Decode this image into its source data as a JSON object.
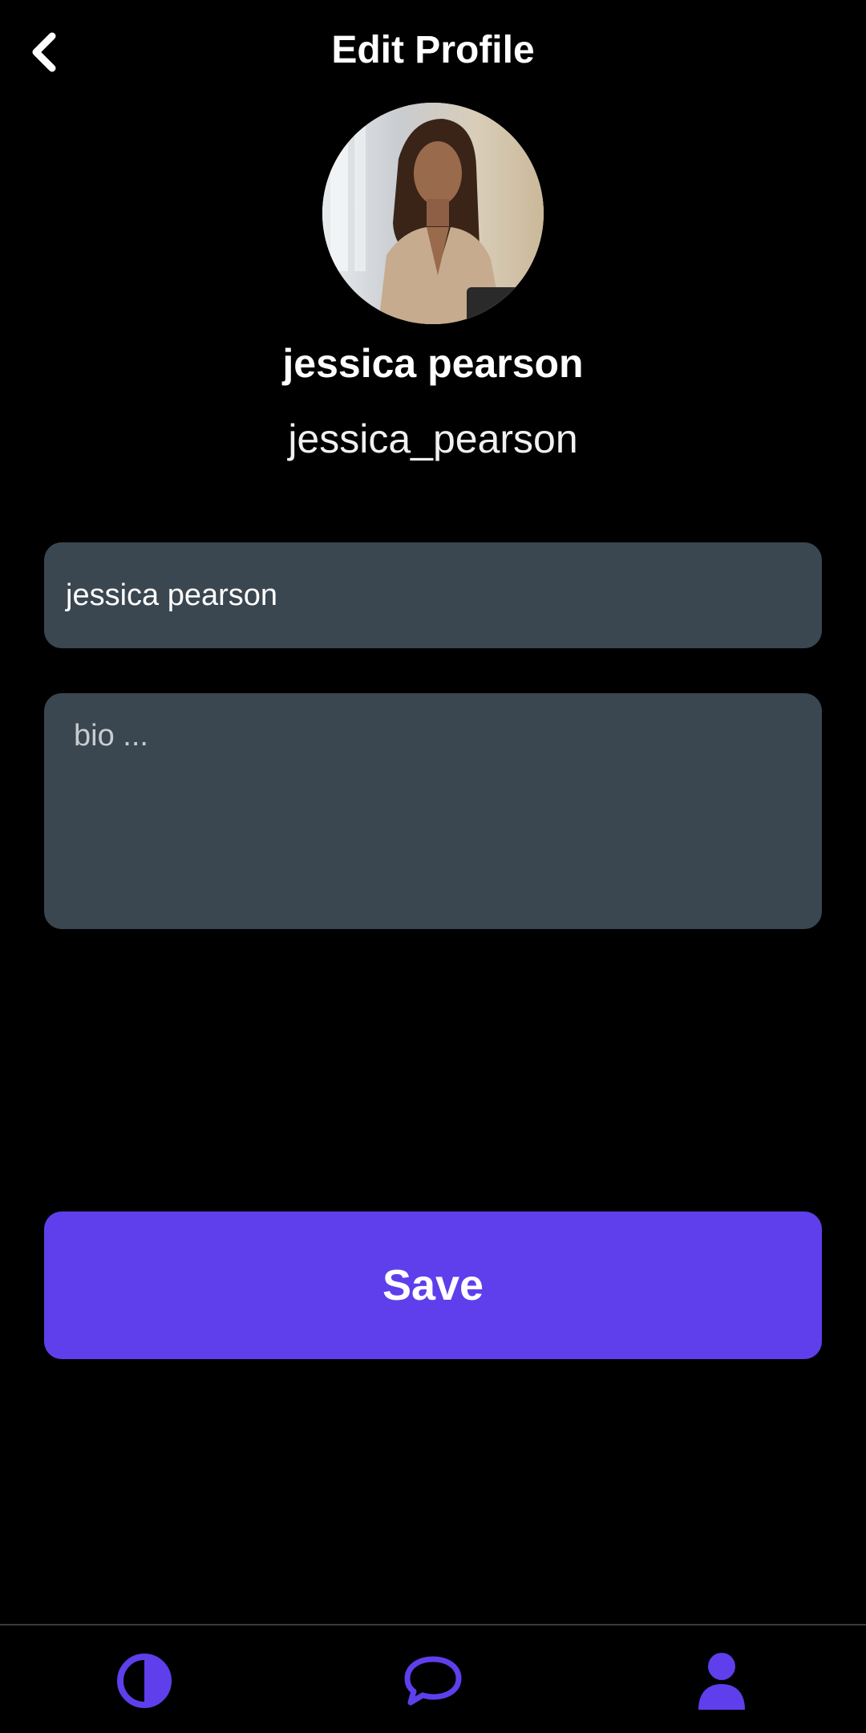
{
  "header": {
    "title": "Edit Profile",
    "back_icon": "chevron-left-icon"
  },
  "profile": {
    "display_name": "jessica pearson",
    "username": "jessica_pearson"
  },
  "form": {
    "name_value": "jessica pearson",
    "bio_placeholder": "bio ..."
  },
  "actions": {
    "save_label": "Save"
  },
  "bottom_nav": {
    "items": [
      {
        "icon": "theme-half-circle-icon"
      },
      {
        "icon": "chat-bubble-icon"
      },
      {
        "icon": "person-icon"
      }
    ]
  },
  "colors": {
    "background": "#000000",
    "accent": "#5e3feb",
    "field_bg": "#3a4650",
    "text": "#ffffff"
  }
}
